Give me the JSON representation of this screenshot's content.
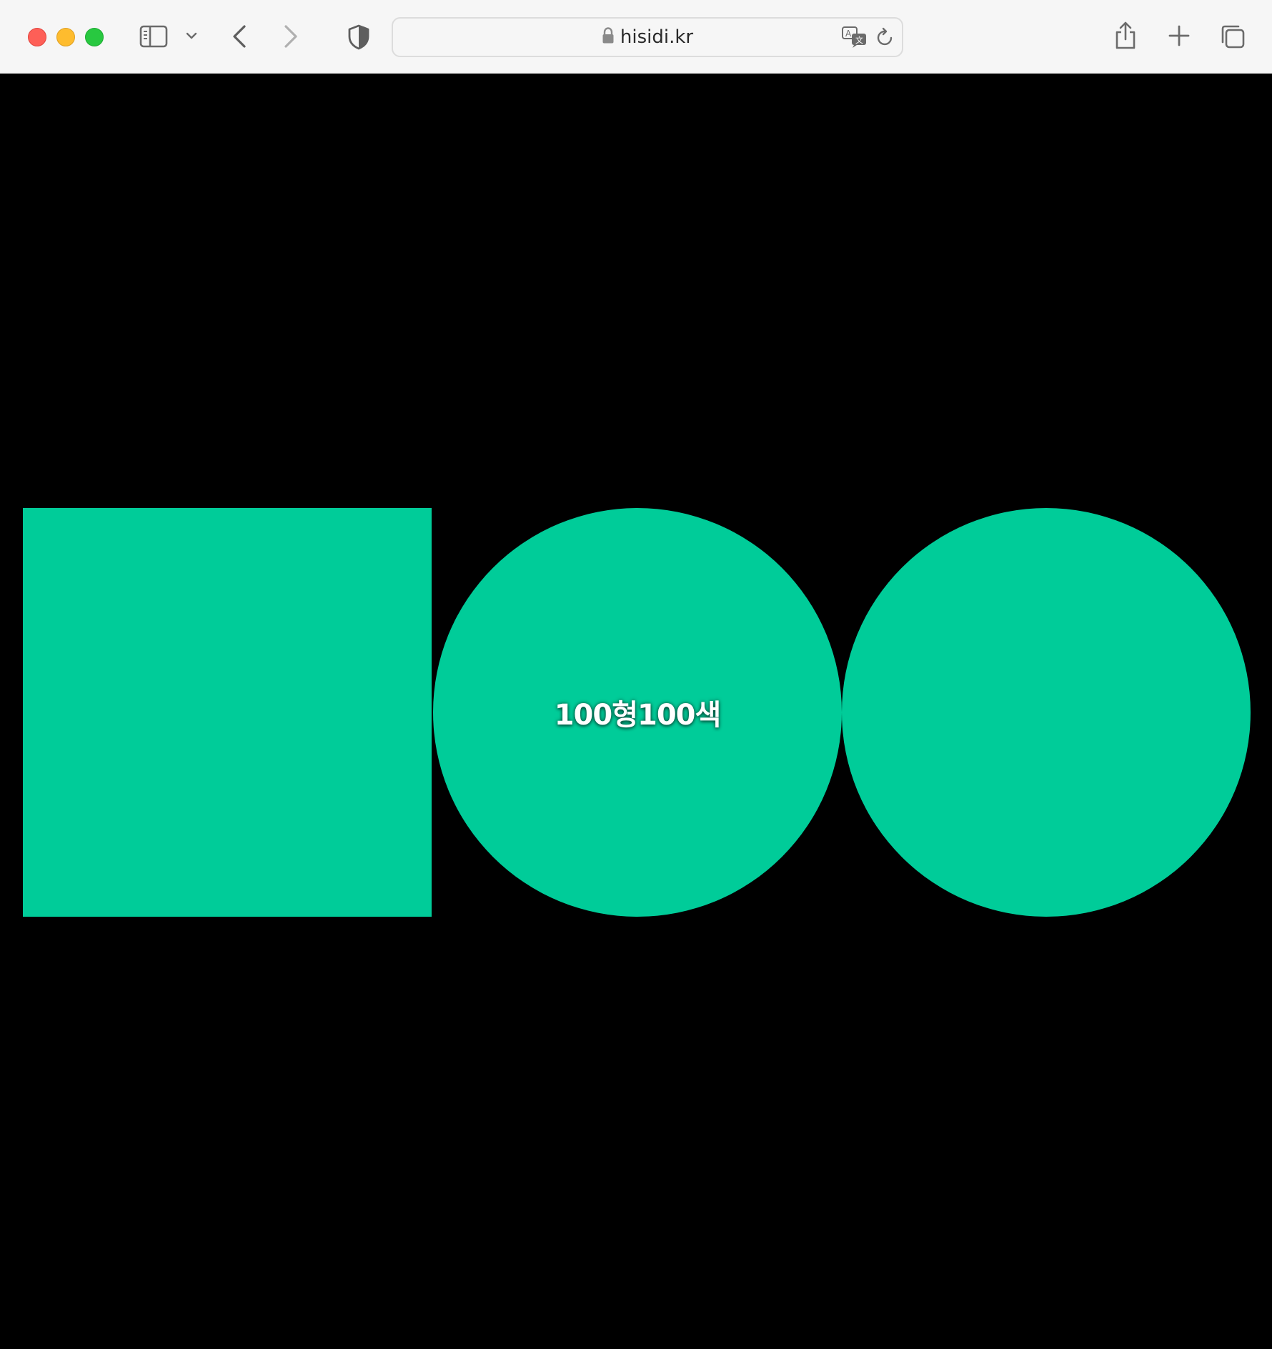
{
  "browser": {
    "url": "hisidi.kr",
    "icons": {
      "sidebar": "sidebar-icon",
      "chevron": "chevron-down-icon",
      "back": "back-arrow-icon",
      "forward": "forward-arrow-icon",
      "shield": "shield-icon",
      "lock": "lock-icon",
      "translate": "translate-icon",
      "reload": "reload-icon",
      "share": "share-icon",
      "new_tab": "plus-icon",
      "tabs": "tab-overview-icon"
    }
  },
  "page": {
    "background": "#000000",
    "accent": "#00cc99",
    "center_label": "100형100색",
    "shapes": [
      "square",
      "circle",
      "circle"
    ]
  }
}
